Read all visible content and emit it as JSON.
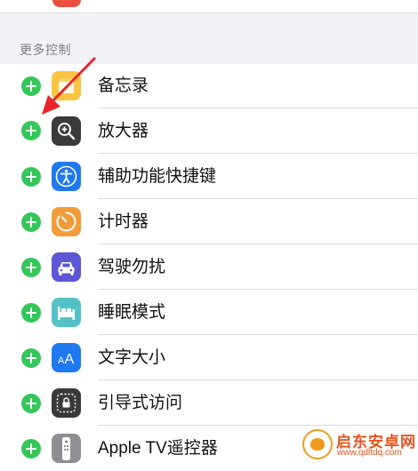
{
  "section": {
    "header": "更多控制"
  },
  "items": [
    {
      "label": "备忘录",
      "icon": "notes-icon",
      "icon_color": "#f9c440"
    },
    {
      "label": "放大器",
      "icon": "magnifier-icon",
      "icon_color": "#3a3a3c"
    },
    {
      "label": "辅助功能快捷键",
      "icon": "accessibility-icon",
      "icon_color": "#1f79ef"
    },
    {
      "label": "计时器",
      "icon": "timer-icon",
      "icon_color": "#f19c38"
    },
    {
      "label": "驾驶勿扰",
      "icon": "car-icon",
      "icon_color": "#5b57d6"
    },
    {
      "label": "睡眠模式",
      "icon": "bed-icon",
      "icon_color": "#54c1c8"
    },
    {
      "label": "文字大小",
      "icon": "text-size-icon",
      "icon_color": "#1f79ef",
      "icon_text": "AA"
    },
    {
      "label": "引导式访问",
      "icon": "lock-icon",
      "icon_color": "#3a3a3c"
    },
    {
      "label": "Apple TV遥控器",
      "icon": "remote-icon",
      "icon_color": "#8e8e93"
    }
  ],
  "colors": {
    "add_button": "#34c759",
    "background": "#f2f2f7",
    "annotation_arrow": "#e8262b"
  },
  "watermark": {
    "title": "启东安卓网",
    "url": "www.qdltdq.com"
  }
}
